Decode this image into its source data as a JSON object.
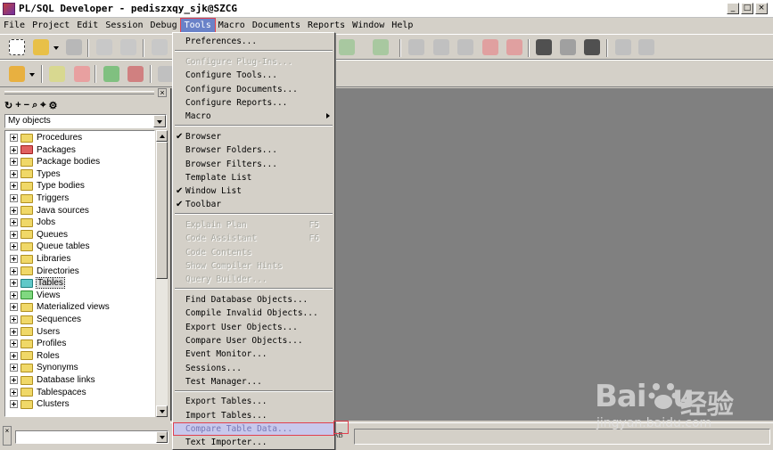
{
  "window": {
    "title": "PL/SQL Developer - pediszxqy_sjk@SZCG",
    "buttons": [
      "_",
      "□",
      "×"
    ]
  },
  "menubar": {
    "items": [
      "File",
      "Project",
      "Edit",
      "Session",
      "Debug",
      "Tools",
      "Macro",
      "Documents",
      "Reports",
      "Window",
      "Help"
    ],
    "active": "Tools"
  },
  "tools_menu": {
    "preferences": "Preferences...",
    "configure_plugins": "Configure Plug-Ins...",
    "configure_tools": "Configure Tools...",
    "configure_documents": "Configure Documents...",
    "configure_reports": "Configure Reports...",
    "macro": "Macro",
    "browser": "Browser",
    "browser_folders": "Browser Folders...",
    "browser_filters": "Browser Filters...",
    "template_list": "Template List",
    "window_list": "Window List",
    "toolbar": "Toolbar",
    "explain_plan": "Explain Plan",
    "explain_plan_shortcut": "F5",
    "code_assistant": "Code Assistant",
    "code_assistant_shortcut": "F6",
    "code_contents": "Code Contents",
    "show_compiler_hints": "Show Compiler Hints",
    "query_builder": "Query Builder...",
    "find_database_objects": "Find Database Objects...",
    "compile_invalid_objects": "Compile Invalid Objects...",
    "export_user_objects": "Export User Objects...",
    "compare_user_objects": "Compare User Objects...",
    "event_monitor": "Event Monitor...",
    "sessions": "Sessions...",
    "test_manager": "Test Manager...",
    "export_tables": "Export Tables...",
    "import_tables": "Import Tables...",
    "compare_table_data": "Compare Table Data...",
    "text_importer": "Text Importer..."
  },
  "left_panel": {
    "filter": "My objects",
    "tree": [
      "Procedures",
      "Packages",
      "Package bodies",
      "Types",
      "Type bodies",
      "Triggers",
      "Java sources",
      "Jobs",
      "Queues",
      "Queue tables",
      "Libraries",
      "Directories",
      "Tables",
      "Views",
      "Materialized views",
      "Sequences",
      "Users",
      "Profiles",
      "Roles",
      "Synonyms",
      "Database links",
      "Tablespaces",
      "Clusters"
    ],
    "selected": "Tables"
  },
  "statusbar": {
    "suffix": "AB"
  },
  "watermark": {
    "logo": "Bai",
    "logo_end": "u",
    "cn": "经验",
    "url": "jingyan.baidu.com"
  },
  "colors": {
    "menu_highlight": "#6a82c8",
    "selection_outline": "#e04050",
    "mdi_background": "#808080"
  }
}
